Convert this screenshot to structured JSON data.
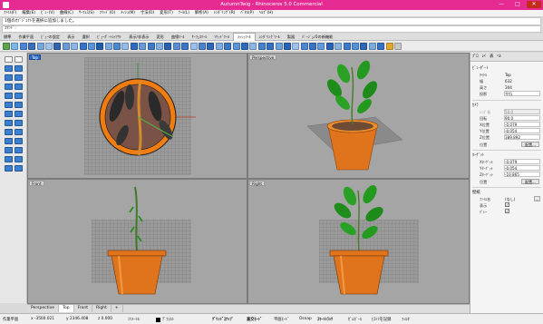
{
  "window": {
    "title": "AutumnTwig - Rhinoceros 5.0 Commercial",
    "controls": [
      "—",
      "□",
      "✕"
    ]
  },
  "menubar": {
    "items": [
      "ﾌｧｲﾙ(F)",
      "編集(E)",
      "ﾋﾞｭｰ(V)",
      "曲線(C)",
      "ｻｰﾌｪｽ(S)",
      "ｿﾘｯﾄﾞ(O)",
      "ﾒｯｼｭ(M)",
      "寸法(D)",
      "変形(T)",
      "ﾂｰﾙ(L)",
      "解析(A)",
      "ﾚﾝﾀﾞﾘﾝｸﾞ(R)",
      "ﾊﾟﾈﾙ(P)",
      "ﾍﾙﾌﾟ(H)"
    ]
  },
  "command": {
    "history": "1個のｵﾌﾞｼﾞｪｸﾄを選択に追加しました。",
    "prompt": "ｺﾏﾝﾄﾞ:"
  },
  "tabs": {
    "items": [
      "標準",
      "作業平面",
      "ﾋﾞｭｰの設定",
      "表示",
      "選択",
      "ﾋﾞｭｰﾎﾟｰﾄﾚｲｱｳﾄ",
      "表示/非表示",
      "変形",
      "曲線ﾂｰﾙ",
      "ｻｰﾌｪｽﾂｰﾙ",
      "ｿﾘｯﾄﾞﾂｰﾙ",
      "ﾒｯｼｭﾂｰﾙ",
      "ﾚﾝﾀﾞﾘﾝｸﾞﾂｰﾙ",
      "製図",
      "ﾊﾞｰｼﾞｮﾝ5の新機能"
    ],
    "active_index": 11
  },
  "viewports": {
    "top": {
      "label": "Top"
    },
    "perspective": {
      "label": "Perspective"
    },
    "front": {
      "label": "Front"
    },
    "right": {
      "label": "Right"
    }
  },
  "viewport_tabs": {
    "items": [
      "Perspective",
      "Top",
      "Front",
      "Right",
      "+"
    ],
    "active_index": 1
  },
  "statusbar": {
    "cplane": "作業平面",
    "x": "x -3500.021",
    "y": "y 2346.408",
    "z": "z 0.000",
    "units": "ﾐﾘﾒｰﾄﾙ",
    "layer": "ﾃﾞﾌｫﾙﾄ",
    "grid_snap": "ｸﾞﾘｯﾄﾞｽﾅｯﾌﾟ",
    "ortho": "直交ﾓｰﾄﾞ",
    "planar": "平面ﾓｰﾄﾞ",
    "osnap": "Osnap",
    "smarttrack": "ｽﾏｰﾄﾄﾗｯｸ",
    "gumball": "ｶﾞﾑﾎﾞｰﾙ",
    "record_history": "ﾋｽﾄﾘを記録",
    "filter": "ﾌｨﾙﾀ"
  },
  "panel": {
    "tabs": [
      "ﾌﾟﾛ",
      "ﾚｲ",
      "表",
      "ﾍﾙ"
    ],
    "viewport_section": "ﾋﾞｭｰﾎﾟｰﾄ",
    "title_label": "ﾀｲﾄﾙ",
    "title_value": "Top",
    "width_label": "幅",
    "width_value": "632",
    "height_label": "高さ",
    "height_value": "304",
    "projection_label": "投影",
    "projection_value": "平行",
    "camera_section": "ｶﾒﾗ",
    "lens_label": "ﾚﾝｽﾞ長",
    "lens_value": "50.0",
    "rotation_label": "回転",
    "rotation_value": "90.0",
    "xloc_label": "X位置",
    "xloc_value": "-0.079",
    "yloc_label": "Y位置",
    "yloc_value": "-0.054",
    "zloc_label": "Z位置",
    "zloc_value": "389.892",
    "position_label": "位置",
    "place_button": "配置...",
    "target_section": "ﾀｰｹﾞｯﾄ",
    "xtarget_label": "Xﾀｰｹﾞｯﾄ",
    "xtarget_value": "-0.079",
    "ytarget_label": "Yﾀｰｹﾞｯﾄ",
    "ytarget_value": "-0.054",
    "ztarget_label": "Zﾀｰｹﾞｯﾄ",
    "ztarget_value": "-10.865",
    "target_position_label": "位置",
    "target_place_button": "配置...",
    "wallpaper_section": "壁紙",
    "filename_label": "ﾌｧｲﾙ名",
    "filename_value": "(なし)",
    "show_label": "表示",
    "gray_label": "ｸﾞﾚｰ"
  },
  "colors": {
    "titlebar": "#e52b91",
    "viewport_bg": "#a5a5a5",
    "pot_orange": "#e0741c",
    "leaf_green": "#239a1f",
    "active_label": "#2d6ac4"
  }
}
